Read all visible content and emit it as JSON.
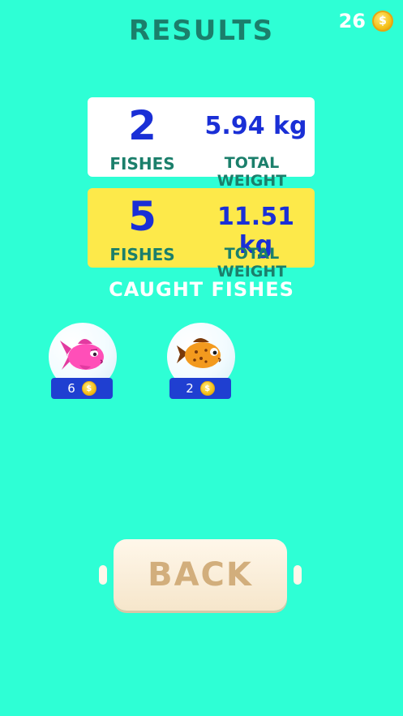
{
  "header": {
    "title": "RESULTS",
    "coins": "26",
    "coin_icon": "coin-icon"
  },
  "current_catch": {
    "fishes_count": "2",
    "fishes_label": "FISHES",
    "weight": "5.94 kg",
    "weight_label": "TOTAL WEIGHT"
  },
  "best_catch": {
    "fishes_count": "5",
    "fishes_label": "FISHES",
    "weight": "11.51 kg",
    "weight_label": "TOTAL WEIGHT"
  },
  "caught_section": {
    "title": "CAUGHT FISHES",
    "fishes": [
      {
        "icon": "pink-fish-icon",
        "price": "6"
      },
      {
        "icon": "orange-spotted-fish-icon",
        "price": "2"
      }
    ]
  },
  "back_button": {
    "label": "BACK"
  },
  "colors": {
    "background": "#2effd5",
    "accent_blue": "#1a2fd6",
    "teal_text": "#1b7f6b",
    "best_panel": "#fde94a"
  }
}
